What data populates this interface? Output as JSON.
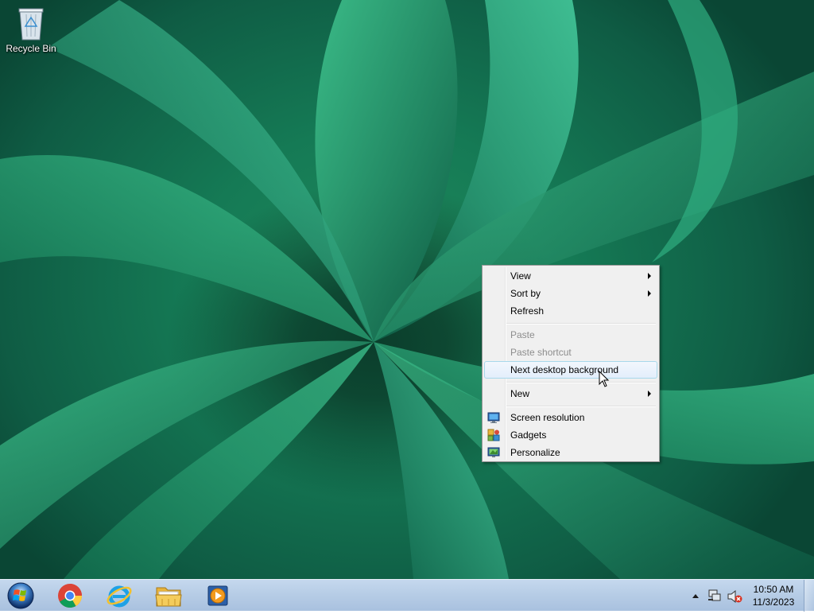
{
  "desktop": {
    "icons": [
      {
        "label": "Recycle Bin",
        "icon": "recycle-bin-icon"
      }
    ]
  },
  "context_menu": {
    "items": [
      {
        "label": "View",
        "submenu": true
      },
      {
        "label": "Sort by",
        "submenu": true
      },
      {
        "label": "Refresh"
      },
      {
        "label": "Paste",
        "disabled": true
      },
      {
        "label": "Paste shortcut",
        "disabled": true
      },
      {
        "label": "Next desktop background",
        "highlighted": true
      },
      {
        "label": "New",
        "submenu": true
      },
      {
        "label": "Screen resolution",
        "icon": "display-icon"
      },
      {
        "label": "Gadgets",
        "icon": "gadgets-icon"
      },
      {
        "label": "Personalize",
        "icon": "personalize-icon"
      }
    ]
  },
  "taskbar": {
    "start_icon": "windows-orb-icon",
    "pinned": [
      {
        "name": "Google Chrome",
        "icon": "chrome-icon"
      },
      {
        "name": "Internet Explorer",
        "icon": "internet-explorer-icon"
      },
      {
        "name": "Windows Explorer",
        "icon": "folder-icon"
      },
      {
        "name": "Windows Media Player",
        "icon": "media-player-icon"
      }
    ],
    "tray": {
      "icons": [
        "show-hidden-icons-chevron-icon",
        "network-icon",
        "volume-muted-icon"
      ],
      "time": "10:50 AM",
      "date": "11/3/2023"
    }
  },
  "colors": {
    "menu_background": "#f0f0f0",
    "menu_highlight_border": "#a8d8eb",
    "disabled_text": "#8d8d8d",
    "taskbar": "#b7cde6",
    "wallpaper_green": "#157a55"
  }
}
